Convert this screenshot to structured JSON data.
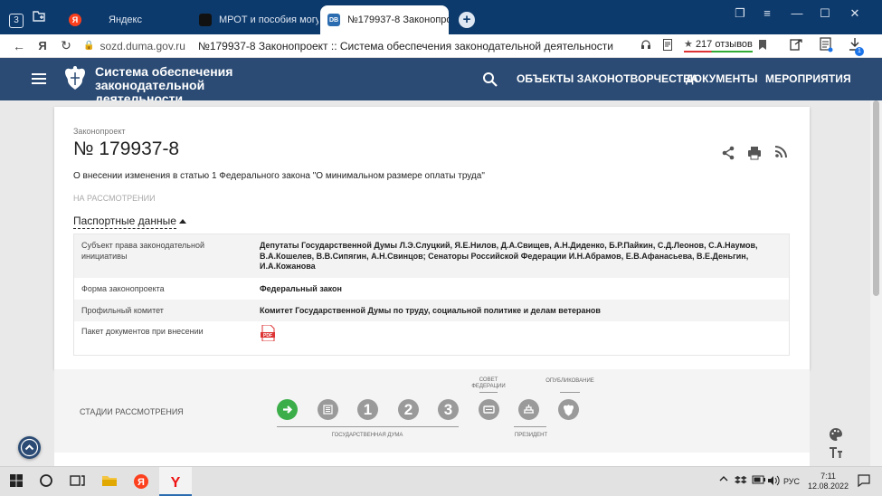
{
  "browser": {
    "tab_count": "3",
    "tabs": [
      {
        "label": "Яндекс",
        "favicon": "Я",
        "favicon_color": "#fc3f1d"
      },
      {
        "label": "МРОТ и пособия могут су",
        "favicon": "■",
        "favicon_color": "#111111"
      },
      {
        "label": "№179937-8 Законопро",
        "favicon": "DB",
        "favicon_color": "#2b6cb0"
      }
    ],
    "host": "sozd.duma.gov.ru",
    "page_title": "№179937-8 Законопроект :: Система обеспечения законодательной деятельности",
    "reviews": "217 отзывов",
    "download_badge": "1"
  },
  "site": {
    "logo_line1": "Система обеспечения",
    "logo_line2": "законодательной деятельности",
    "nav": [
      "ОБЪЕКТЫ ЗАКОНОТВОРЧЕСТВА",
      "ДОКУМЕНТЫ",
      "МЕРОПРИЯТИЯ"
    ],
    "header_color": "#2b4b74"
  },
  "bill": {
    "kind_label": "Законопроект",
    "number": "№ 179937-8",
    "title": "О внесении изменения в статью 1 Федерального закона \"О минимальном размере оплаты труда\"",
    "status": "НА РАССМОТРЕНИИ",
    "passport_label": "Паспортные данные",
    "passport": [
      {
        "key": "Субъект права законодательной инициативы",
        "value": "Депутаты Государственной Думы Л.Э.Слуцкий, Я.Е.Нилов, Д.А.Свищев, А.Н.Диденко, Б.Р.Пайкин, С.Д.Леонов, С.А.Наумов, В.А.Кошелев, В.В.Сипягин, А.Н.Свинцов; Сенаторы Российской Федерации И.Н.Абрамов, Е.В.Афанасьева, В.Е.Деньгин, И.А.Кожанова"
      },
      {
        "key": "Форма законопроекта",
        "value": "Федеральный закон"
      },
      {
        "key": "Профильный комитет",
        "value": "Комитет Государственной Думы по труду, социальной политике и делам ветеранов"
      },
      {
        "key": "Пакет документов при внесении",
        "value": ""
      }
    ]
  },
  "stages": {
    "label": "СТАДИИ РАССМОТРЕНИЯ",
    "numbers": [
      "1",
      "2",
      "3"
    ],
    "council_line1": "СОВЕТ",
    "council_line2": "ФЕДЕРАЦИИ",
    "published": "ОПУБЛИКОВАНИЕ",
    "duma": "ГОСУДАРСТВЕННАЯ ДУМА",
    "president": "ПРЕЗИДЕНТ",
    "active_color": "#3cae49"
  },
  "taskbar": {
    "lang": "РУС",
    "time": "7:11",
    "date": "12.08.2022"
  }
}
